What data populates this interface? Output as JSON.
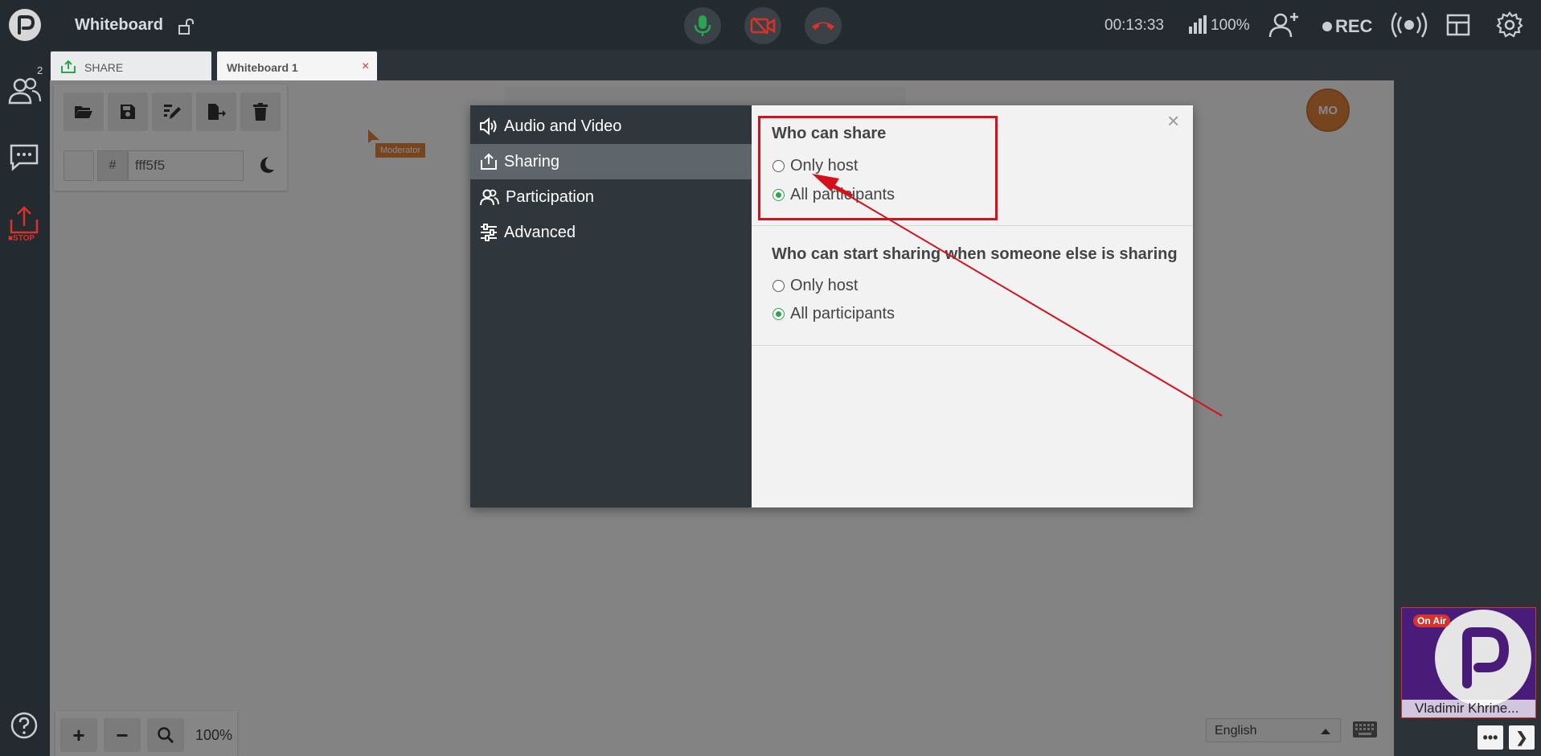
{
  "topbar": {
    "title": "Whiteboard",
    "timer": "00:13:33",
    "signal_percent": "100%",
    "rec_label": "REC"
  },
  "leftrail": {
    "participant_count": "2",
    "stop_label": "■STOP"
  },
  "tabs": [
    {
      "label": "SHARE"
    },
    {
      "label": "Whiteboard 1",
      "close": "×"
    }
  ],
  "whiteboard": {
    "hash_symbol": "#",
    "color_hex": "fff5f5",
    "cursor_label": "Moderator",
    "avatar_initials": "MO",
    "zoom_in": "+",
    "zoom_out": "−",
    "zoom_percent": "100%"
  },
  "language": {
    "selected": "English"
  },
  "video": {
    "badge": "On Air",
    "name": "Vladimir Khrine...",
    "more_btn": "•••",
    "next_btn": "❯"
  },
  "modal": {
    "close": "×",
    "nav": [
      {
        "label": "Audio and Video",
        "icon": "speaker-icon"
      },
      {
        "label": "Sharing",
        "icon": "share-icon",
        "active": true
      },
      {
        "label": "Participation",
        "icon": "participants-icon"
      },
      {
        "label": "Advanced",
        "icon": "sliders-icon"
      }
    ],
    "sections": [
      {
        "title": "Who can share",
        "options": [
          {
            "label": "Only host",
            "checked": false
          },
          {
            "label": "All participants",
            "checked": true
          }
        ]
      },
      {
        "title": "Who can start sharing when someone else is sharing",
        "options": [
          {
            "label": "Only host",
            "checked": false
          },
          {
            "label": "All participants",
            "checked": true
          }
        ]
      }
    ]
  },
  "colors": {
    "accent_green": "#2aa44f",
    "annotation_red": "#d6101b",
    "moderator_orange": "#d9772d"
  }
}
